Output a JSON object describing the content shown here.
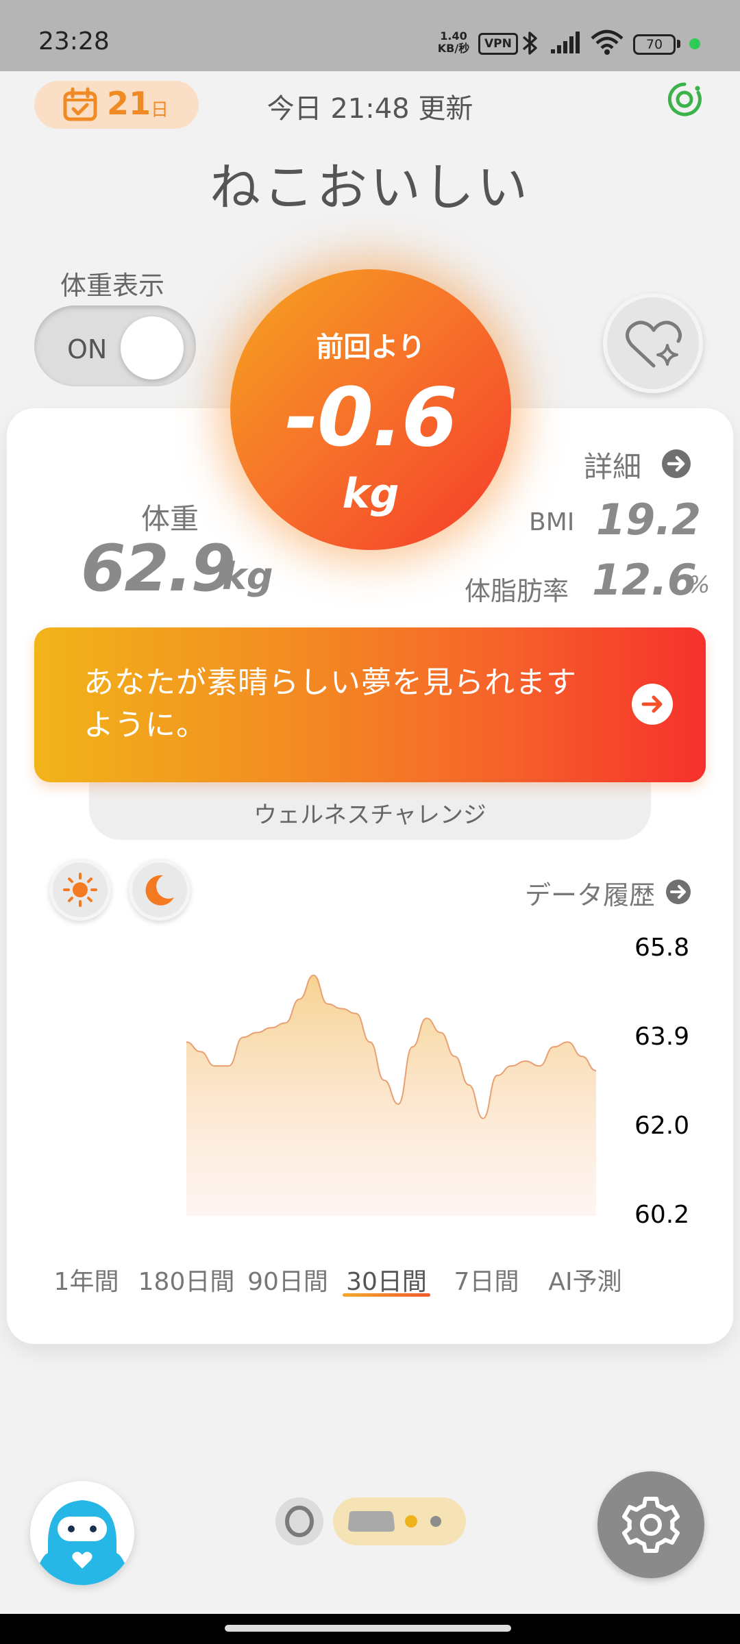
{
  "status_bar": {
    "time": "23:28",
    "net_speed_value": "1.40",
    "net_speed_unit": "KB/秒",
    "vpn": "VPN",
    "battery": "70",
    "icons": [
      "bluetooth-icon",
      "signal-icon",
      "wifi-icon",
      "battery-icon"
    ]
  },
  "header": {
    "day_count": "21",
    "day_unit": "日",
    "update_time": "今日 21:48 更新",
    "user_name": "ねこおいしい"
  },
  "weight_display": {
    "label": "体重表示",
    "toggle_state": "ON"
  },
  "change": {
    "caption": "前回より",
    "value": "-0.6",
    "unit": "kg"
  },
  "weight": {
    "label": "体重",
    "value": "62.9",
    "unit": "kg"
  },
  "metrics": {
    "details_label": "詳細",
    "bmi_label": "BMI",
    "bmi_value": "19.2",
    "body_fat_label": "体脂肪率",
    "body_fat_value": "12.6",
    "body_fat_unit": "%"
  },
  "banner": {
    "message_line1": "あなたが素晴らしい夢を見られます",
    "message_line2": "ように。",
    "wellness_label": "ウェルネスチャレンジ"
  },
  "history": {
    "label": "データ履歴"
  },
  "chart_data": {
    "type": "area",
    "y_ticks": [
      "65.8",
      "63.9",
      "62.0",
      "60.2"
    ],
    "ylim": [
      60.2,
      65.8
    ],
    "x": [
      1,
      2,
      3,
      4,
      5,
      6,
      7,
      8,
      9,
      10,
      11,
      12,
      13,
      14,
      15,
      16,
      17,
      18,
      19,
      20,
      21,
      22,
      23,
      24,
      25,
      26,
      27,
      28,
      29,
      30
    ],
    "values": [
      63.8,
      63.6,
      63.3,
      63.3,
      63.9,
      64.0,
      64.1,
      64.2,
      64.7,
      65.2,
      64.6,
      64.5,
      64.4,
      63.8,
      63.0,
      62.5,
      63.7,
      64.3,
      64.0,
      63.5,
      62.9,
      62.2,
      63.1,
      63.3,
      63.4,
      63.3,
      63.7,
      63.8,
      63.5,
      63.2
    ],
    "colors": {
      "fill_top": "#f6d89a",
      "fill_bottom": "#fde6dc",
      "line": "#e8a070"
    }
  },
  "periods": {
    "tabs": [
      "1年間",
      "180日間",
      "90日間",
      "30日間",
      "7日間",
      "AI予測"
    ],
    "selected": "30日間"
  },
  "colors": {
    "accent_orange": "#f08a24",
    "accent_red": "#f6312c",
    "badge_bg": "#fadfc6",
    "sync_green": "#3cb34a"
  }
}
